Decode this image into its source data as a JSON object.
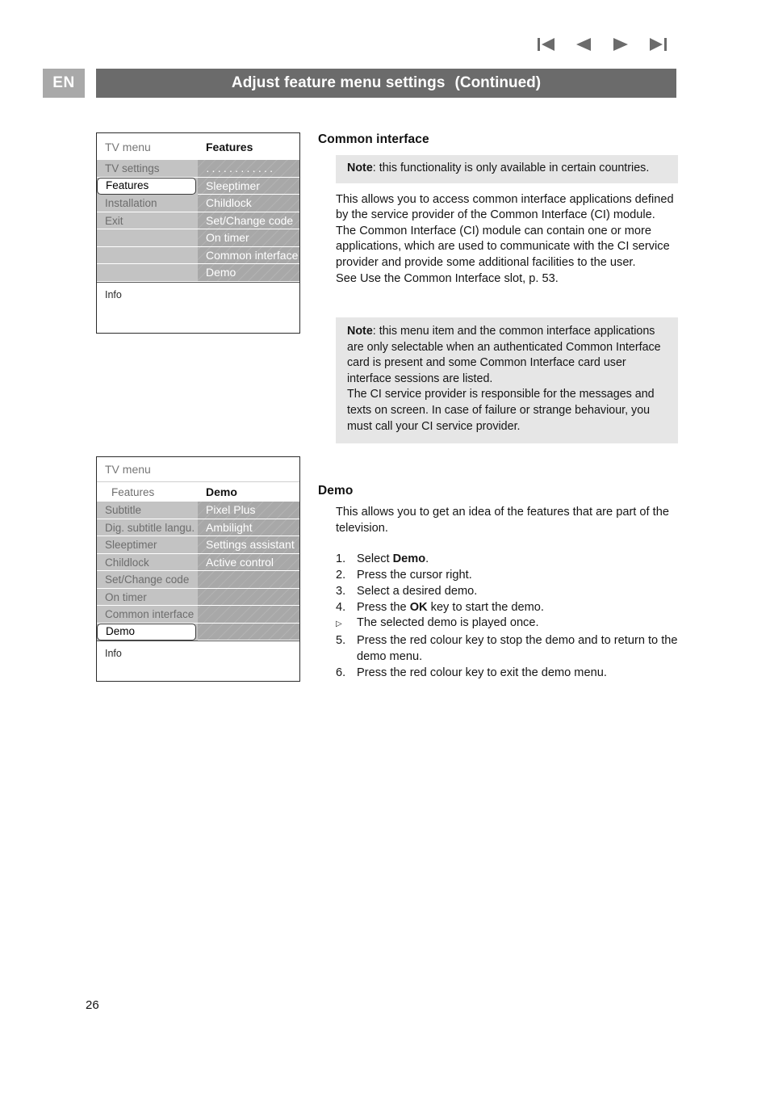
{
  "nav": {
    "icons": [
      "skip-to-first-icon",
      "previous-icon",
      "next-icon",
      "skip-to-last-icon"
    ]
  },
  "header": {
    "language_badge": "EN",
    "title": "Adjust feature menu settings",
    "title_continued": "(Continued)"
  },
  "tv_menu_1": {
    "title_left": "TV menu",
    "title_right": "Features",
    "left_items": [
      "TV settings",
      "Features",
      "Installation",
      "Exit",
      "",
      "",
      ""
    ],
    "left_selected_index": 1,
    "right_items": [
      "············",
      "Sleeptimer",
      "Childlock",
      "Set/Change code",
      "On timer",
      "Common interface",
      "Demo"
    ],
    "info_label": "Info"
  },
  "tv_menu_2": {
    "title_left": "TV menu",
    "title_right": "",
    "sub_left": "Features",
    "sub_right": "Demo",
    "left_items": [
      "Subtitle",
      "Dig. subtitle langu.",
      "Sleeptimer",
      "Childlock",
      "Set/Change code",
      "On timer",
      "Common interface",
      "Demo"
    ],
    "left_selected_index": 7,
    "right_items": [
      "Pixel Plus",
      "Ambilight",
      "Settings assistant",
      "Active control",
      "",
      "",
      "",
      ""
    ],
    "info_label": "Info"
  },
  "common_interface": {
    "heading": "Common interface",
    "note1_label": "Note",
    "note1_text": ": this functionality is only available in certain countries.",
    "body": "This allows you to access common interface applications defined by the service provider of the Common Interface (CI) module.\nThe Common Interface (CI) module can contain one or more applications, which are used to communicate with the CI service provider and provide some additional facilities to the user.\nSee Use the Common Interface slot, p. 53.",
    "note2_label": "Note",
    "note2_text": ": this menu item and the common interface applications are only selectable when an authenticated Common Interface card is present and some Common Interface card user interface sessions are listed.\nThe CI service provider is responsible for the messages and texts on screen. In case of failure or strange behaviour, you must call your CI service provider."
  },
  "demo": {
    "heading": "Demo",
    "intro": "This allows you to get an idea of the features that are part of the television.",
    "steps": [
      {
        "marker": "1.",
        "text_before": "Select ",
        "bold": "Demo",
        "text_after": "."
      },
      {
        "marker": "2.",
        "text_before": "Press the cursor right.",
        "bold": "",
        "text_after": ""
      },
      {
        "marker": "3.",
        "text_before": "Select a desired demo.",
        "bold": "",
        "text_after": ""
      },
      {
        "marker": "4.",
        "text_before": "Press the ",
        "bold": "OK",
        "text_after": " key to start the demo."
      },
      {
        "marker": "▷",
        "text_before": "The selected demo is played once.",
        "bold": "",
        "text_after": ""
      },
      {
        "marker": "5.",
        "text_before": "Press the red colour key to stop the demo and to return to the demo menu.",
        "bold": "",
        "text_after": ""
      },
      {
        "marker": "6.",
        "text_before": "Press the red colour key to exit the demo menu.",
        "bold": "",
        "text_after": ""
      }
    ]
  },
  "footer": {
    "page_number": "26"
  },
  "colors": {
    "header_bar": "#6b6b6b",
    "badge": "#a9a9a9",
    "note_bg": "#e6e6e6",
    "menu_left_col": "#c3c3c3",
    "menu_right_col": "#a8a8a8"
  }
}
